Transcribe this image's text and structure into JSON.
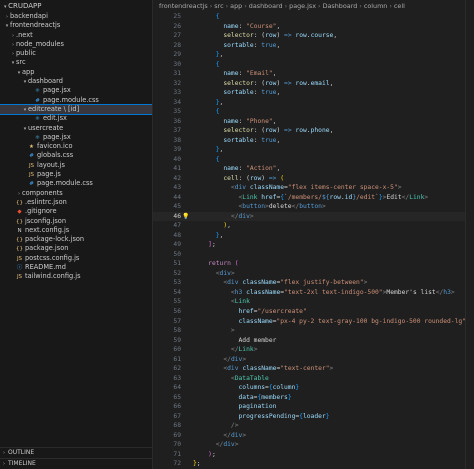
{
  "explorer": {
    "root": "CRUDAPP",
    "items": [
      {
        "label": "backendapi",
        "depth": 0,
        "type": "folder",
        "expanded": false,
        "icon": "chevron-right"
      },
      {
        "label": "frontendreactjs",
        "depth": 0,
        "type": "folder",
        "expanded": true,
        "icon": "chevron-down"
      },
      {
        "label": ".next",
        "depth": 1,
        "type": "folder",
        "expanded": false
      },
      {
        "label": "node_modules",
        "depth": 1,
        "type": "folder",
        "expanded": false
      },
      {
        "label": "public",
        "depth": 1,
        "type": "folder",
        "expanded": false
      },
      {
        "label": "src",
        "depth": 1,
        "type": "folder",
        "expanded": true
      },
      {
        "label": "app",
        "depth": 2,
        "type": "folder",
        "expanded": true
      },
      {
        "label": "dashboard",
        "depth": 3,
        "type": "folder",
        "expanded": true
      },
      {
        "label": "page.jsx",
        "depth": 4,
        "type": "jsx"
      },
      {
        "label": "page.module.css",
        "depth": 4,
        "type": "css"
      },
      {
        "label": "editcreate \\ [id]",
        "depth": 3,
        "type": "folder",
        "expanded": true,
        "selected": true
      },
      {
        "label": "edit.jsx",
        "depth": 4,
        "type": "jsx"
      },
      {
        "label": "usercreate",
        "depth": 3,
        "type": "folder",
        "expanded": true
      },
      {
        "label": "page.jsx",
        "depth": 4,
        "type": "jsx"
      },
      {
        "label": "favicon.ico",
        "depth": 3,
        "type": "ico"
      },
      {
        "label": "globals.css",
        "depth": 3,
        "type": "css"
      },
      {
        "label": "layout.js",
        "depth": 3,
        "type": "js"
      },
      {
        "label": "page.js",
        "depth": 3,
        "type": "js"
      },
      {
        "label": "page.module.css",
        "depth": 3,
        "type": "css"
      },
      {
        "label": "components",
        "depth": 2,
        "type": "folder",
        "expanded": false
      },
      {
        "label": ".eslintrc.json",
        "depth": 1,
        "type": "json"
      },
      {
        "label": ".gitignore",
        "depth": 1,
        "type": "git"
      },
      {
        "label": "jsconfig.json",
        "depth": 1,
        "type": "json"
      },
      {
        "label": "next.config.js",
        "depth": 1,
        "type": "next"
      },
      {
        "label": "package-lock.json",
        "depth": 1,
        "type": "json"
      },
      {
        "label": "package.json",
        "depth": 1,
        "type": "json"
      },
      {
        "label": "postcss.config.js",
        "depth": 1,
        "type": "js"
      },
      {
        "label": "README.md",
        "depth": 1,
        "type": "md"
      },
      {
        "label": "tailwind.config.js",
        "depth": 1,
        "type": "js"
      }
    ],
    "outline": "OUTLINE",
    "timeline": "TIMELINE"
  },
  "breadcrumb": [
    "frontendreactjs",
    "src",
    "app",
    "dashboard",
    "page.jsx",
    "Dashboard",
    "column",
    "cell"
  ],
  "editor": {
    "current_line": "46",
    "lines": [
      {
        "n": "25",
        "html": "      <span class='b3'>{</span>"
      },
      {
        "n": "26",
        "html": "        <span class='v'>name</span><span class='o'>: </span><span class='s'>\"Course\"</span><span class='o'>,</span>"
      },
      {
        "n": "27",
        "html": "        <span class='f'>selector</span><span class='o'>: (</span><span class='v'>row</span><span class='o'>) </span><span class='k'>=&gt;</span><span class='o'> </span><span class='v'>row</span><span class='o'>.</span><span class='v'>course</span><span class='o'>,</span>"
      },
      {
        "n": "28",
        "html": "        <span class='v'>sortable</span><span class='o'>: </span><span class='k'>true</span><span class='o'>,</span>"
      },
      {
        "n": "29",
        "html": "      <span class='b3'>}</span><span class='o'>,</span>"
      },
      {
        "n": "30",
        "html": "      <span class='b3'>{</span>"
      },
      {
        "n": "31",
        "html": "        <span class='v'>name</span><span class='o'>: </span><span class='s'>\"Email\"</span><span class='o'>,</span>"
      },
      {
        "n": "32",
        "html": "        <span class='f'>selector</span><span class='o'>: (</span><span class='v'>row</span><span class='o'>) </span><span class='k'>=&gt;</span><span class='o'> </span><span class='v'>row</span><span class='o'>.</span><span class='v'>email</span><span class='o'>,</span>"
      },
      {
        "n": "33",
        "html": "        <span class='v'>sortable</span><span class='o'>: </span><span class='k'>true</span><span class='o'>,</span>"
      },
      {
        "n": "34",
        "html": "      <span class='b3'>}</span><span class='o'>,</span>"
      },
      {
        "n": "35",
        "html": "      <span class='b3'>{</span>"
      },
      {
        "n": "36",
        "html": "        <span class='v'>name</span><span class='o'>: </span><span class='s'>\"Phone\"</span><span class='o'>,</span>"
      },
      {
        "n": "37",
        "html": "        <span class='f'>selector</span><span class='o'>: (</span><span class='v'>row</span><span class='o'>) </span><span class='k'>=&gt;</span><span class='o'> </span><span class='v'>row</span><span class='o'>.</span><span class='v'>phone</span><span class='o'>,</span>"
      },
      {
        "n": "38",
        "html": "        <span class='v'>sortable</span><span class='o'>: </span><span class='k'>true</span><span class='o'>,</span>"
      },
      {
        "n": "39",
        "html": "      <span class='b3'>}</span><span class='o'>,</span>"
      },
      {
        "n": "40",
        "html": "      <span class='b3'>{</span>"
      },
      {
        "n": "41",
        "html": "        <span class='v'>name</span><span class='o'>: </span><span class='s'>\"Action\"</span><span class='o'>,</span>"
      },
      {
        "n": "42",
        "html": "        <span class='f'>cell</span><span class='o'>: (</span><span class='v'>row</span><span class='o'>) </span><span class='k'>=&gt;</span><span class='o'> </span><span class='b'>(</span>"
      },
      {
        "n": "43",
        "html": "          <span class='br'>&lt;</span><span class='t'>div</span> <span class='a'>className</span><span class='o'>=</span><span class='s'>\"flex items-center space-x-5\"</span><span class='br'>&gt;</span>"
      },
      {
        "n": "44",
        "html": "            <span class='br'>&lt;</span><span class='c'>Link</span> <span class='a'>href</span><span class='o'>=</span><span class='b3'>{</span><span class='s'>`/members/</span><span class='k'>${</span><span class='v'>row</span><span class='o'>.</span><span class='v'>id</span><span class='k'>}</span><span class='s'>/edit`</span><span class='b3'>}</span><span class='br'>&gt;</span><span class='o'>Edit</span><span class='br'>&lt;/</span><span class='c'>Link</span><span class='br'>&gt;</span>"
      },
      {
        "n": "45",
        "html": "            <span class='br'>&lt;</span><span class='t'>button</span><span class='br'>&gt;</span><span class='o'>delete</span><span class='br'>&lt;/</span><span class='t'>button</span><span class='br'>&gt;</span>"
      },
      {
        "n": "46",
        "html": "          <span class='br'>&lt;/</span><span class='t'>div</span><span class='br'>&gt;</span>"
      },
      {
        "n": "47",
        "html": "        <span class='b'>)</span><span class='o'>,</span>"
      },
      {
        "n": "48",
        "html": "      <span class='b3'>}</span><span class='o'>,</span>"
      },
      {
        "n": "49",
        "html": "    <span class='b2'>]</span><span class='o'>;</span>"
      },
      {
        "n": "50",
        "html": ""
      },
      {
        "n": "51",
        "html": "    <span class='kw'>return</span><span class='o'> </span><span class='b2'>(</span>"
      },
      {
        "n": "52",
        "html": "      <span class='br'>&lt;</span><span class='t'>div</span><span class='br'>&gt;</span>"
      },
      {
        "n": "53",
        "html": "        <span class='br'>&lt;</span><span class='t'>div</span> <span class='a'>className</span><span class='o'>=</span><span class='s'>\"flex justify-between\"</span><span class='br'>&gt;</span>"
      },
      {
        "n": "54",
        "html": "          <span class='br'>&lt;</span><span class='t'>h3</span> <span class='a'>className</span><span class='o'>=</span><span class='s'>\"text-2xl text-indigo-500\"</span><span class='br'>&gt;</span><span class='o'>Member's list</span><span class='br'>&lt;/</span><span class='t'>h3</span><span class='br'>&gt;</span>"
      },
      {
        "n": "55",
        "html": "          <span class='br'>&lt;</span><span class='c'>Link</span>"
      },
      {
        "n": "56",
        "html": "            <span class='a'>href</span><span class='o'>=</span><span class='s'>\"/usercreate\"</span>"
      },
      {
        "n": "57",
        "html": "            <span class='a'>className</span><span class='o'>=</span><span class='s'>\"px-4 py-2 text-gray-100 bg-indigo-500 rounded-lg\"</span>"
      },
      {
        "n": "58",
        "html": "          <span class='br'>&gt;</span>"
      },
      {
        "n": "59",
        "html": "            <span class='o'>Add member</span>"
      },
      {
        "n": "60",
        "html": "          <span class='br'>&lt;/</span><span class='c'>Link</span><span class='br'>&gt;</span>"
      },
      {
        "n": "61",
        "html": "        <span class='br'>&lt;/</span><span class='t'>div</span><span class='br'>&gt;</span>"
      },
      {
        "n": "62",
        "html": "        <span class='br'>&lt;</span><span class='t'>div</span> <span class='a'>className</span><span class='o'>=</span><span class='s'>\"text-center\"</span><span class='br'>&gt;</span>"
      },
      {
        "n": "63",
        "html": "          <span class='br'>&lt;</span><span class='c'>DataTable</span>"
      },
      {
        "n": "64",
        "html": "            <span class='a'>columns</span><span class='o'>=</span><span class='b3'>{</span><span class='v'>column</span><span class='b3'>}</span>"
      },
      {
        "n": "65",
        "html": "            <span class='a'>data</span><span class='o'>=</span><span class='b3'>{</span><span class='v'>members</span><span class='b3'>}</span>"
      },
      {
        "n": "66",
        "html": "            <span class='a'>pagination</span>"
      },
      {
        "n": "67",
        "html": "            <span class='a'>progressPending</span><span class='o'>=</span><span class='b3'>{</span><span class='v'>loader</span><span class='b3'>}</span>"
      },
      {
        "n": "68",
        "html": "          <span class='br'>/&gt;</span>"
      },
      {
        "n": "69",
        "html": "        <span class='br'>&lt;/</span><span class='t'>div</span><span class='br'>&gt;</span>"
      },
      {
        "n": "70",
        "html": "      <span class='br'>&lt;/</span><span class='t'>div</span><span class='br'>&gt;</span>"
      },
      {
        "n": "71",
        "html": "    <span class='b2'>)</span><span class='o'>;</span>"
      },
      {
        "n": "72",
        "html": "<span class='b'>}</span><span class='o'>;</span>"
      }
    ]
  },
  "icon_colors": {
    "folder": "#c5c5c5",
    "jsx": "#4fc1ff",
    "css": "#42a5f5",
    "js": "#e5c07b",
    "json": "#e5c07b",
    "ico": "#e5c07b",
    "git": "#f14e32",
    "md": "#42a5f5",
    "next": "#cccccc"
  }
}
